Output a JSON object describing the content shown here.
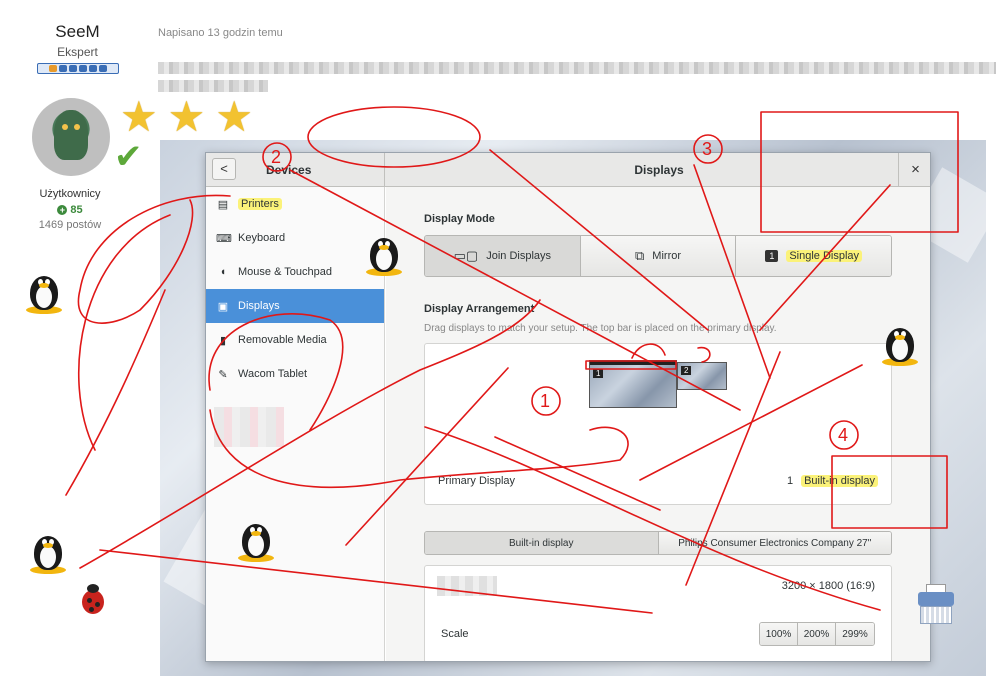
{
  "post": {
    "author": "SeeM",
    "rank": "Ekspert",
    "group": "Użytkownicy",
    "reputation": "85",
    "posts": "1469 postów",
    "date": "Napisano 13 godzin temu"
  },
  "window": {
    "panel_title": "Devices",
    "title": "Displays",
    "back_label": "<",
    "close_label": "×"
  },
  "sidebar": {
    "items": [
      {
        "label": "Printers",
        "icon": "printer-icon"
      },
      {
        "label": "Keyboard",
        "icon": "keyboard-icon"
      },
      {
        "label": "Mouse & Touchpad",
        "icon": "mouse-icon"
      },
      {
        "label": "Displays",
        "icon": "display-icon"
      },
      {
        "label": "Removable Media",
        "icon": "usb-icon"
      },
      {
        "label": "Wacom Tablet",
        "icon": "tablet-icon"
      }
    ]
  },
  "display_mode": {
    "title": "Display Mode",
    "options": [
      {
        "label": "Join Displays",
        "icon": "join-displays-icon"
      },
      {
        "label": "Mirror",
        "icon": "mirror-icon"
      },
      {
        "label": "Single Display",
        "icon": "single-display-icon",
        "badge": "1"
      }
    ],
    "selected": "Join Displays"
  },
  "arrangement": {
    "title": "Display Arrangement",
    "hint": "Drag displays to match your setup. The top bar is placed on the primary display.",
    "monitors": [
      {
        "label": "1"
      },
      {
        "label": "2"
      }
    ]
  },
  "primary_display": {
    "label": "Primary Display",
    "number": "1",
    "value": "Built-in display"
  },
  "display_tabs": [
    "Built-in display",
    "Philips Consumer Electronics Company 27\""
  ],
  "resolution": "3200 × 1800 (16:9)",
  "scale": {
    "label": "Scale",
    "options": [
      "100%",
      "200%",
      "299%"
    ]
  },
  "annotations": [
    "1",
    "2",
    "3",
    "4"
  ],
  "colors": {
    "highlight": "#fbf279",
    "selected_sidebar": "#4a90d9",
    "annotation_red": "#e01818"
  }
}
